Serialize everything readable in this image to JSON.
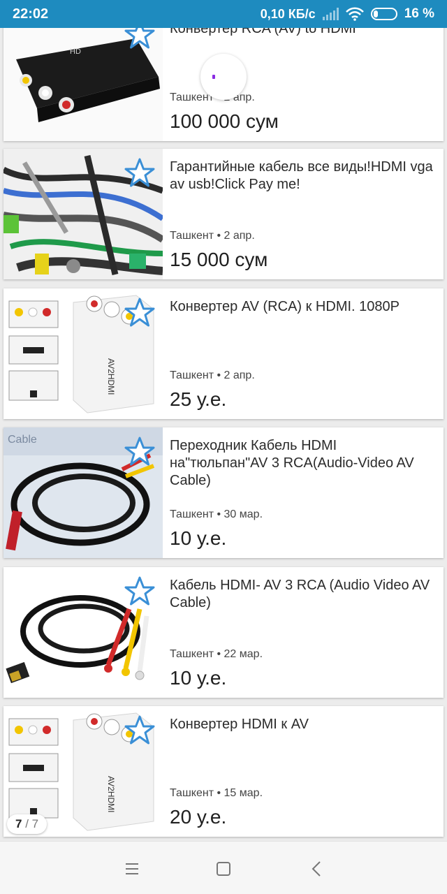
{
  "status_bar": {
    "time": "22:02",
    "speed": "0,10 КБ/с",
    "battery": "16 %"
  },
  "listings": [
    {
      "title": "Конвертер RCA (AV) to HDMI",
      "meta": "Ташкент • 2 апр.",
      "price": "100 000 сум",
      "image": "converter-box-photo"
    },
    {
      "title": "Гарантийные кабель все виды!HDMI vga av usb!Click Pay me!",
      "meta": "Ташкент • 2 апр.",
      "price": "15 000 сум",
      "image": "cables-photo"
    },
    {
      "title": "Конвертер AV (RCA) к HDMI. 1080P",
      "meta": "Ташкент • 2 апр.",
      "price": "25 у.е.",
      "image": "mini-converter-photo"
    },
    {
      "title": "Переходник Кабель HDMI на\"тюльпан\"AV 3 RCA(Audio-Video AV Cable)",
      "meta": "Ташкент • 30 мар.",
      "price": "10 у.е.",
      "image": "hdmi-cable-package-photo"
    },
    {
      "title": "Кабель HDMI- AV 3 RCA (Audio Video AV Cable)",
      "meta": "Ташкент • 22 мар.",
      "price": "10 у.е.",
      "image": "hdmi-rca-cable-photo"
    },
    {
      "title": "Конвертер HDMI к AV",
      "meta": "Ташкент • 15 мар.",
      "price": "20 у.е.",
      "image": "mini-converter-photo"
    }
  ],
  "pager": {
    "current": "7",
    "separator": " / ",
    "total": "7"
  },
  "colors": {
    "status_bar": "#1e8bbf",
    "favorite_star": "#3a8fd6",
    "spinner": "#8a2be2"
  }
}
